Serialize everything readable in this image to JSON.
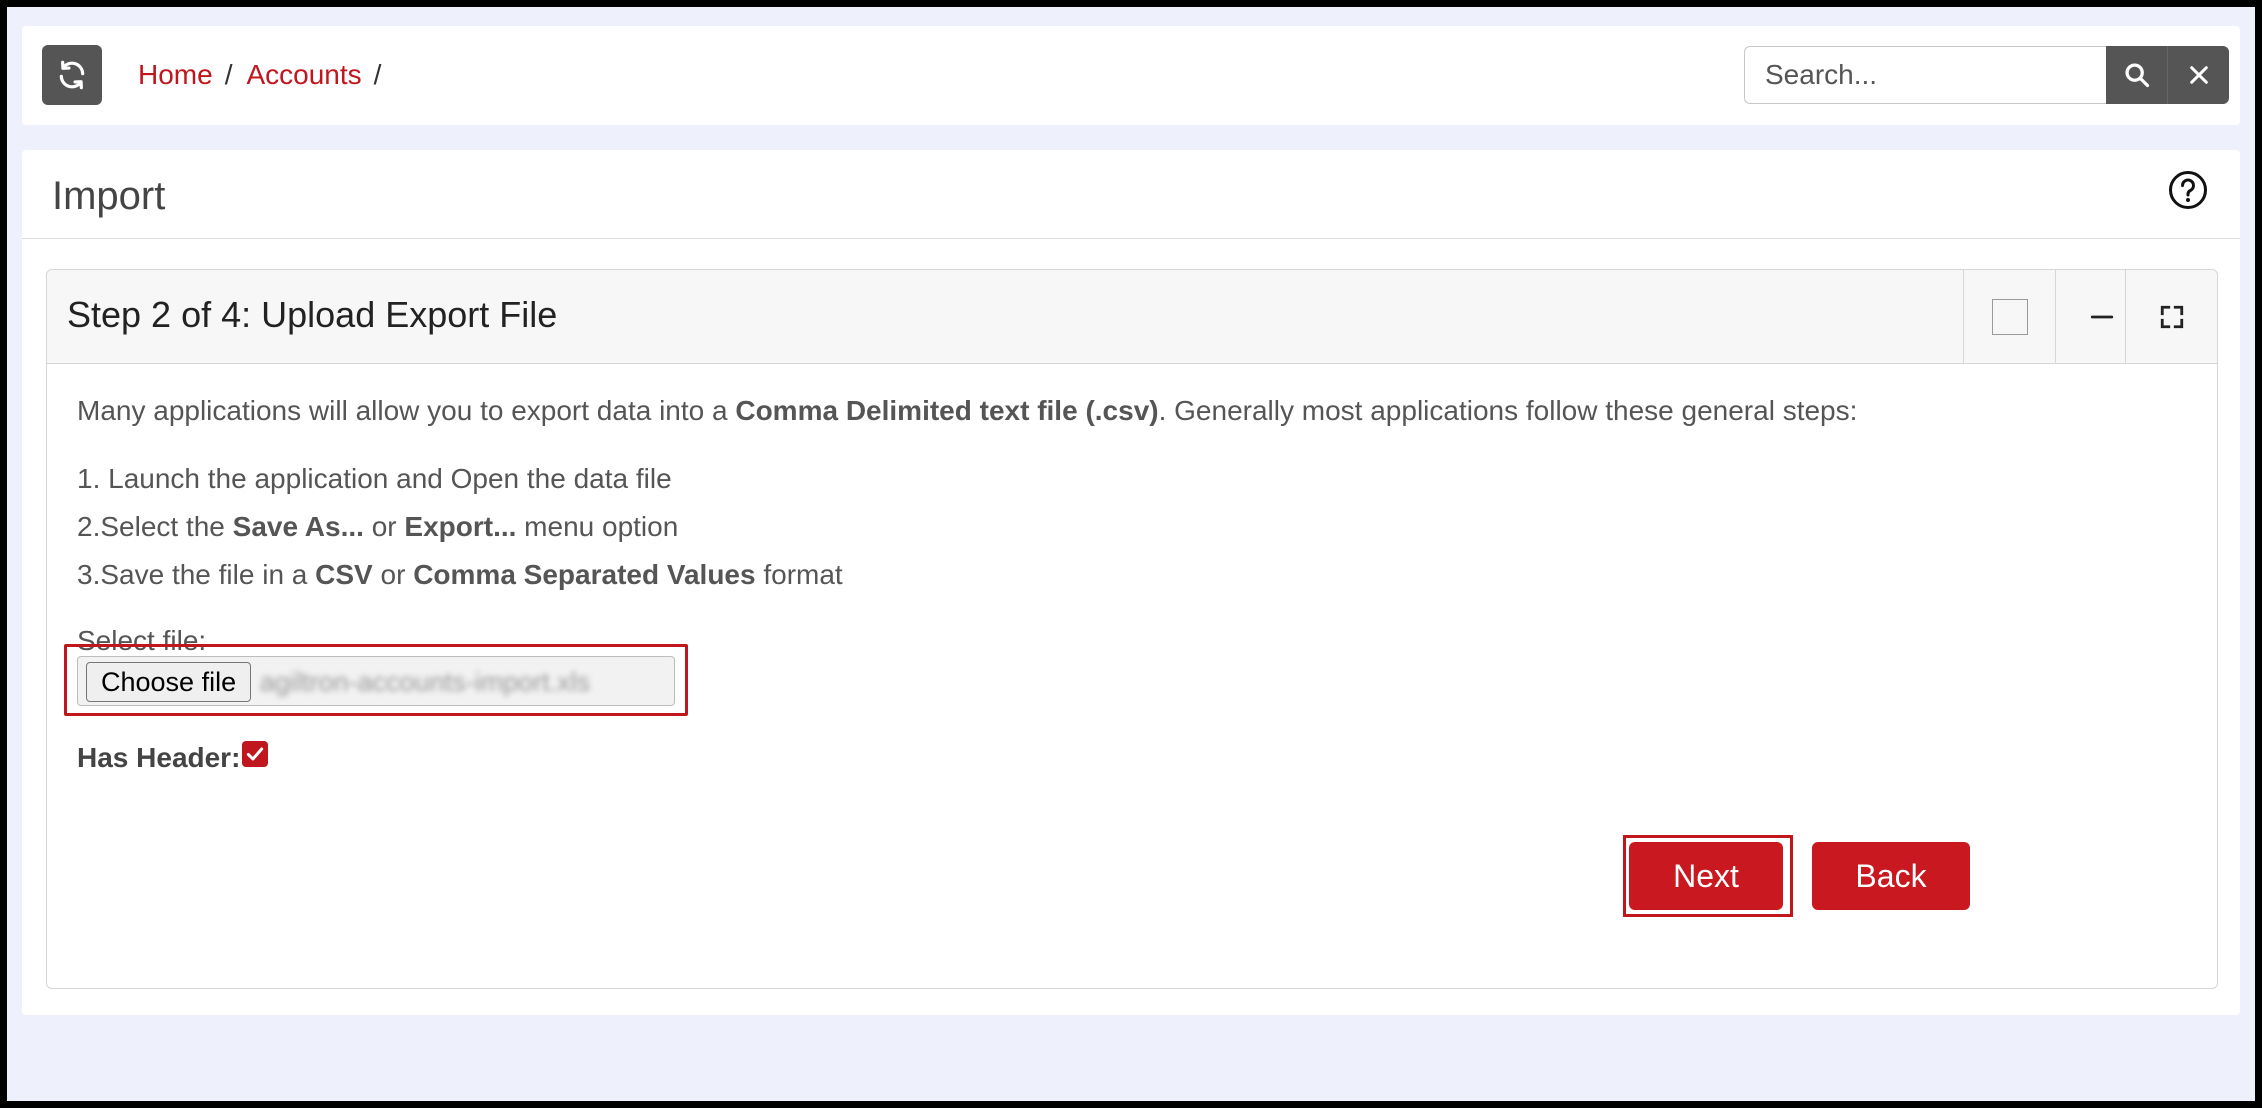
{
  "topbar": {
    "breadcrumb": [
      {
        "label": "Home"
      },
      {
        "label": "Accounts"
      }
    ],
    "separator": "/",
    "search_placeholder": "Search...",
    "search_value": ""
  },
  "page": {
    "title": "Import"
  },
  "card": {
    "title": "Step 2 of 4: Upload Export File",
    "intro_pre": "Many applications will allow you to export data into a ",
    "intro_bold": "Comma Delimited text file (.csv)",
    "intro_post": ". Generally most applications follow these general steps:",
    "step1": "1. Launch the application and Open the data file",
    "step2_pre": "2.Select the ",
    "step2_bold1": "Save As...",
    "step2_mid": " or ",
    "step2_bold2": "Export...",
    "step2_post": " menu option",
    "step3_pre": "3.Save the file in a ",
    "step3_bold1": "CSV",
    "step3_mid": " or ",
    "step3_bold2": "Comma Separated Values",
    "step3_post": " format",
    "select_label": "Select file:",
    "choose_file_label": "Choose file",
    "file_name": "agiltron-accounts-import.xls",
    "has_header_label": "Has Header:",
    "has_header_checked": true,
    "next_label": "Next",
    "back_label": "Back"
  },
  "colors": {
    "accent": "#c9181f",
    "link": "#c0161d",
    "dark_button": "#555555",
    "background": "#eef0fb"
  },
  "icons": {
    "refresh": "refresh-icon",
    "search": "search-icon",
    "clear": "close-icon",
    "help": "help-circle-icon",
    "select": "checkbox-icon",
    "minimize": "minus-icon",
    "expand": "expand-icon"
  }
}
